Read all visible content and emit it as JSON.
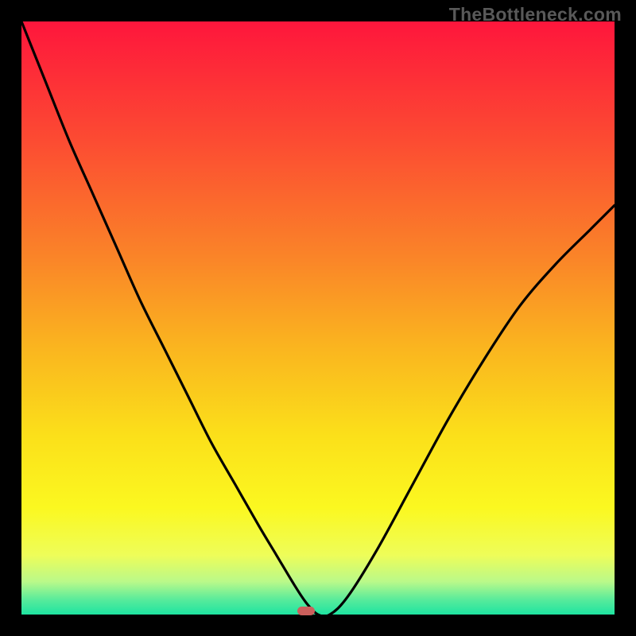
{
  "watermark": "TheBottleneck.com",
  "marker": {
    "color": "#cb5f5c",
    "x_pct": 48,
    "y_pct": 100
  },
  "chart_data": {
    "type": "line",
    "title": "",
    "xlabel": "",
    "ylabel": "",
    "xlim": [
      0,
      100
    ],
    "ylim": [
      0,
      100
    ],
    "grid": false,
    "legend": false,
    "background_gradient": {
      "stops": [
        {
          "offset": 0.0,
          "color": "#fe163c"
        },
        {
          "offset": 0.2,
          "color": "#fc4b32"
        },
        {
          "offset": 0.4,
          "color": "#fa8528"
        },
        {
          "offset": 0.55,
          "color": "#fab51f"
        },
        {
          "offset": 0.7,
          "color": "#fbe01a"
        },
        {
          "offset": 0.82,
          "color": "#fbf820"
        },
        {
          "offset": 0.9,
          "color": "#eefd59"
        },
        {
          "offset": 0.945,
          "color": "#b9f98a"
        },
        {
          "offset": 0.975,
          "color": "#58eb9b"
        },
        {
          "offset": 1.0,
          "color": "#1ee4a1"
        }
      ]
    },
    "series": [
      {
        "name": "curve",
        "x": [
          0,
          4,
          8,
          12,
          16,
          20,
          24,
          28,
          32,
          36,
          40,
          43,
          46,
          48,
          50,
          52,
          55,
          60,
          66,
          72,
          78,
          84,
          90,
          96,
          100
        ],
        "y": [
          100,
          90,
          80,
          71,
          62,
          53,
          45,
          37,
          29,
          22,
          15,
          10,
          5,
          2,
          0,
          0,
          3,
          11,
          22,
          33,
          43,
          52,
          59,
          65,
          69
        ]
      }
    ],
    "marker": {
      "name": "highlight",
      "x": 48,
      "y": 0,
      "color": "#cb5f5c"
    }
  }
}
